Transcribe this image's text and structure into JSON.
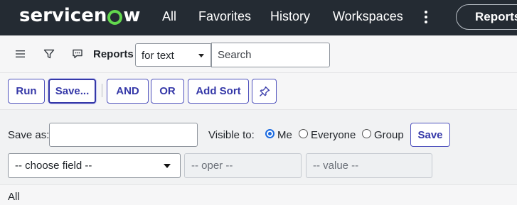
{
  "topnav": {
    "logo_text_a": "servicen",
    "logo_text_b": "w",
    "links": [
      "All",
      "Favorites",
      "History",
      "Workspaces"
    ],
    "more_icon": "kebab-vertical-icon",
    "context_pill": "Reports",
    "colors": {
      "background": "#242b33",
      "logo_accent": "#62d84e"
    }
  },
  "toolbar": {
    "icons": [
      "hamburger-menu-icon",
      "filter-funnel-icon",
      "chat-bubble-icon"
    ],
    "title": "Reports",
    "search_scope": "for text",
    "search_placeholder": "Search"
  },
  "actions": {
    "run": "Run",
    "save": "Save...",
    "and": "AND",
    "or": "OR",
    "add_sort": "Add Sort",
    "pin_icon": "pin-icon",
    "accent": "#3538a8"
  },
  "save_row": {
    "save_as_label": "Save as:",
    "save_as_value": "",
    "visible_to_label": "Visible to:",
    "options": [
      "Me",
      "Everyone",
      "Group"
    ],
    "selected": "Me",
    "save_button": "Save"
  },
  "condition": {
    "field": "-- choose field --",
    "operator": "-- oper --",
    "value": "-- value --"
  },
  "footer": {
    "breadcrumb": "All"
  }
}
